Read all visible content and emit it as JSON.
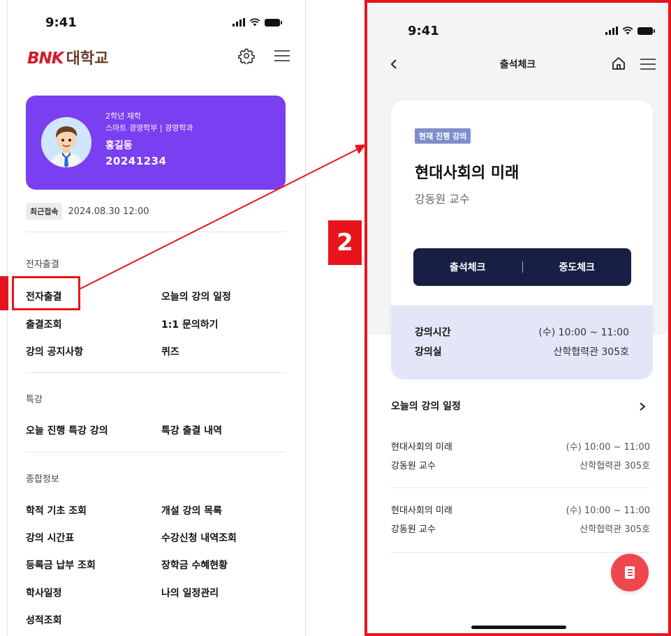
{
  "left": {
    "status_time": "9:41",
    "logo_mark": "BNK",
    "logo_name": "대학교",
    "profile": {
      "grade": "2학년 재학",
      "dept": "스마트 경영학부 | 경영학과",
      "name": "홍길동",
      "student_id": "20241234"
    },
    "recent": {
      "tag": "최근접속",
      "datetime": "2024.08.30 12:00"
    },
    "sections": {
      "attendance": {
        "title": "전자출결",
        "items": [
          "전자출결",
          "오늘의 강의 일정",
          "출결조회",
          "1:1 문의하기",
          "강의 공지사항",
          "퀴즈"
        ]
      },
      "special": {
        "title": "특강",
        "items": [
          "오늘 진행 특강 강의",
          "특강 출결 내역"
        ]
      },
      "info": {
        "title": "종합정보",
        "items": [
          "학적 기초 조회",
          "개설 강의 목록",
          "강의 시간표",
          "수강신청 내역조회",
          "등록금 납부 조회",
          "장학금 수혜현황",
          "학사일정",
          "나의 일정관리",
          "성적조회"
        ]
      }
    }
  },
  "badge": "2",
  "right": {
    "status_time": "9:41",
    "title": "출석체크",
    "card": {
      "tag": "현재 진행 강의",
      "lecture": "현대사회의 미래",
      "professor": "강동원 교수",
      "btn_attend": "출석체크",
      "btn_mid": "중도체크",
      "time_label": "강의시간",
      "time_value": "(수) 10:00 ~ 11:00",
      "room_label": "강의실",
      "room_value": "산학협력관 305호"
    },
    "schedule_title": "오늘의 강의 일정",
    "schedule": [
      {
        "lecture": "현대사회의 미래",
        "professor": "강동원 교수",
        "time": "(수) 10:00 ~ 11:00",
        "room": "산학협력관 305호"
      },
      {
        "lecture": "현대사회의 미래",
        "professor": "강동원 교수",
        "time": "(수) 10:00 ~ 11:00",
        "room": "산학협력관 305호"
      }
    ]
  },
  "colors": {
    "accent_purple": "#7b3ff2",
    "highlight_red": "#e8141c",
    "navy_button": "#171f45",
    "info_bg": "#e2e6f6",
    "fab_red": "#f0474e"
  },
  "icons": [
    "gear-icon",
    "hamburger-icon",
    "back-chevron-icon",
    "home-icon",
    "chevron-right-icon",
    "document-icon"
  ]
}
